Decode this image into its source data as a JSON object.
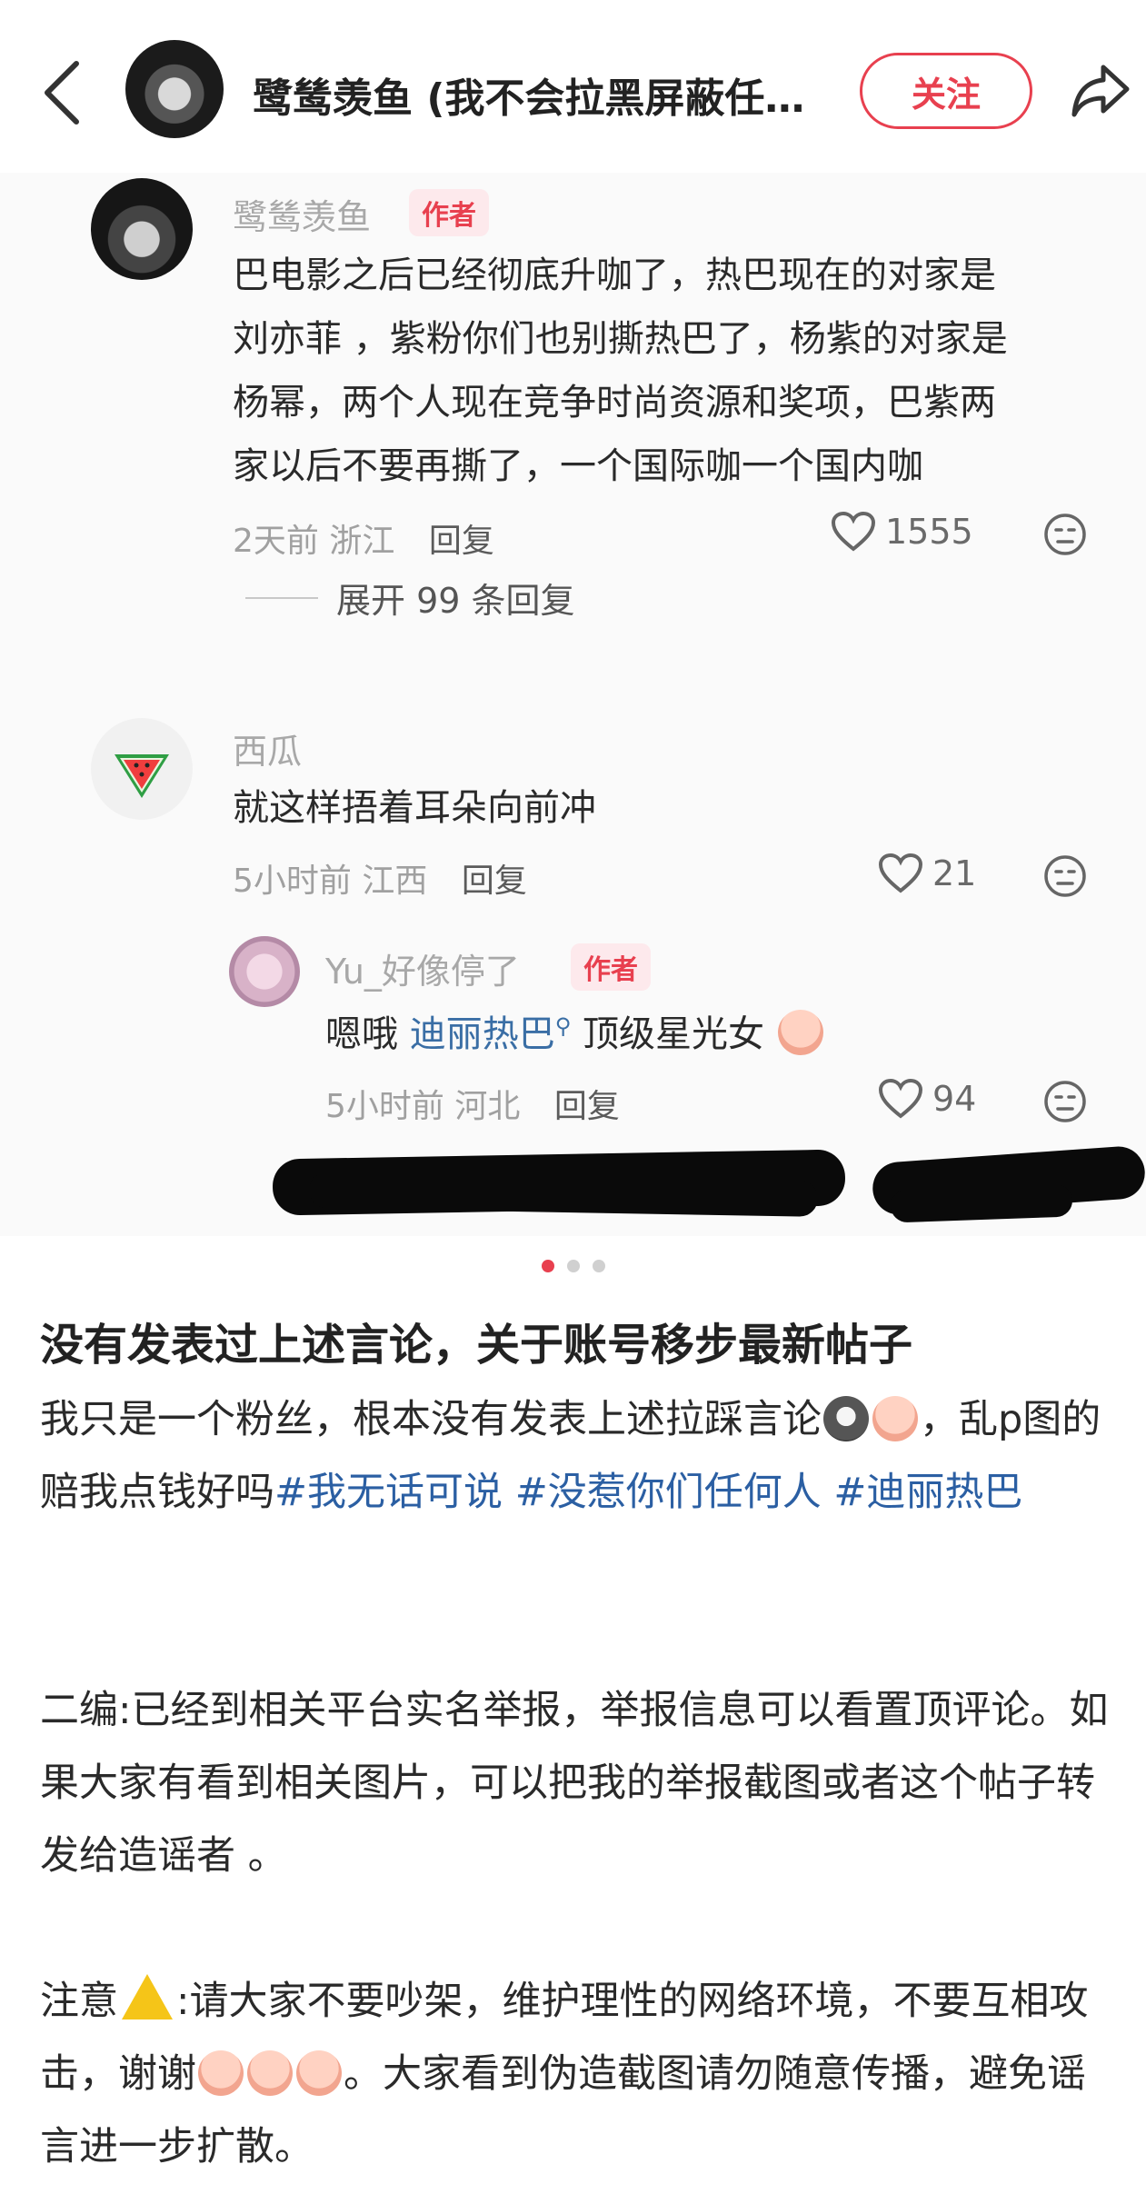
{
  "nav": {
    "title": "鹭鸶羡鱼 (我不会拉黑屏蔽任…",
    "follow_label": "关注"
  },
  "image": {
    "comments": [
      {
        "author": "鹭鸶羡鱼",
        "badge": "作者",
        "lines": [
          "巴电影之后已经彻底升咖了，热巴现在的对家是",
          "刘亦菲 ，紫粉你们也别撕热巴了，杨紫的对家是",
          "杨幂，两个人现在竞争时尚资源和奖项，巴紫两",
          "家以后不要再撕了，一个国际咖一个国内咖"
        ],
        "time": "2天前",
        "location": "浙江",
        "reply_label": "回复",
        "likes": "1555",
        "expand_label": "展开 99 条回复"
      },
      {
        "author": "西瓜",
        "text": "就这样捂着耳朵向前冲",
        "time": "5小时前",
        "location": "江西",
        "reply_label": "回复",
        "likes": "21"
      },
      {
        "author": "Yu_好像停了",
        "badge": "作者",
        "text_prefix": "嗯哦",
        "mention": "迪丽热巴",
        "text_suffix": "顶级星光女",
        "time": "5小时前",
        "location": "河北",
        "reply_label": "回复",
        "likes": "94"
      }
    ],
    "carousel": {
      "total": 3,
      "current": 1
    }
  },
  "post": {
    "title": "没有发表过上述言论，关于账号移步最新帖子",
    "p1_a": "我只是一个粉丝，根本没有发表上述拉踩言论",
    "p1_b": "，乱",
    "p1_c": "p图的赔我点钱好吗",
    "hashtags": [
      "#我无话可说",
      "#没惹你们任何人",
      "#迪",
      "丽热巴"
    ],
    "p2": "二编:已经到相关平台实名举报，举报信息可以看置顶评论。如果大家有看到相关图片，可以把我的举报截图或者这个帖子转发给造谣者 。",
    "p3_a": "注意",
    "p3_b": ":请大家不要吵架，维护理性的网络环境，不要互相攻击，谢谢",
    "p3_c": "。大家看到伪造截图请勿随意传播，避免谣言进一步扩散。"
  },
  "colors": {
    "accent": "#e8404f",
    "hashtag": "#2b5fa3",
    "mention": "#3a6ea5"
  }
}
